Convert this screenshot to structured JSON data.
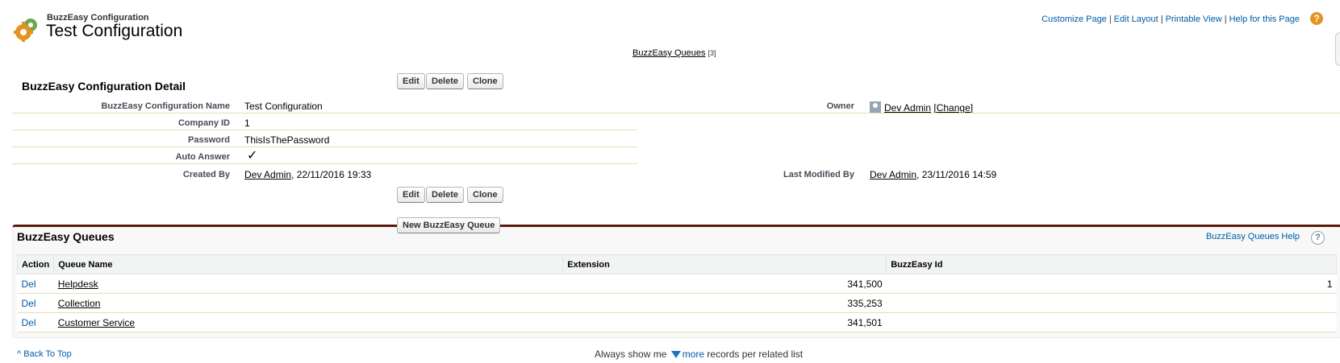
{
  "header": {
    "subtitle": "BuzzEasy Configuration",
    "title": "Test Configuration",
    "links": [
      "Customize Page",
      "Edit Layout",
      "Printable View",
      "Help for this Page"
    ]
  },
  "related_link": {
    "label": "BuzzEasy Queues",
    "count": "[3]"
  },
  "detail": {
    "title": "BuzzEasy Configuration Detail",
    "buttons": {
      "edit": "Edit",
      "delete": "Delete",
      "clone": "Clone"
    },
    "fields": {
      "name_label": "BuzzEasy Configuration Name",
      "name_value": "Test Configuration",
      "company_label": "Company ID",
      "company_value": "1",
      "password_label": "Password",
      "password_value": "ThisIsThePassword",
      "auto_answer_label": "Auto Answer",
      "auto_answer_check": "✓",
      "created_label": "Created By",
      "created_user": "Dev Admin",
      "created_date": ", 22/11/2016 19:33",
      "owner_label": "Owner",
      "owner_value": "Dev Admin",
      "owner_change": "[Change]",
      "modified_label": "Last Modified By",
      "modified_user": "Dev Admin",
      "modified_date": ", 23/11/2016 14:59"
    }
  },
  "queues": {
    "title": "BuzzEasy Queues",
    "new_button": "New BuzzEasy Queue",
    "help": "BuzzEasy Queues Help",
    "help_icon": "?",
    "columns": {
      "action": "Action",
      "name": "Queue Name",
      "extension": "Extension",
      "id": "BuzzEasy Id"
    },
    "rows": [
      {
        "action": "Del",
        "name": "Helpdesk",
        "extension": "341,500",
        "id": "1"
      },
      {
        "action": "Del",
        "name": "Collection",
        "extension": "335,253",
        "id": ""
      },
      {
        "action": "Del",
        "name": "Customer Service",
        "extension": "341,501",
        "id": ""
      }
    ]
  },
  "footer": {
    "back_to_top": "Back To Top",
    "always_show": "Always show me",
    "more": "more",
    "records": "records per related list"
  }
}
